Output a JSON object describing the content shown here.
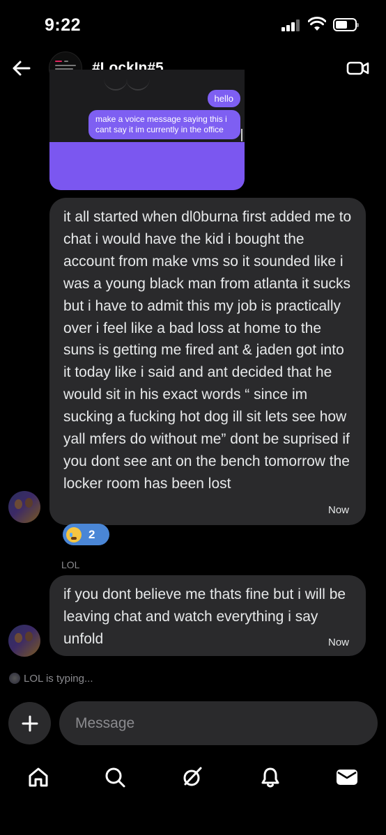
{
  "status_bar": {
    "time": "9:22"
  },
  "header": {
    "title": "#LockIn#5"
  },
  "shared_image": {
    "bubble_hello": "hello",
    "bubble_message": "make a voice message saying this i cant say it im currently in the office"
  },
  "messages": [
    {
      "text": "it all started when dl0burna first added me to chat i would have the kid i bought the account from make vms so it sounded like i was a young black man from atlanta it sucks but i have to admit this my job is practically over i feel like a bad loss at home to the suns is getting me fired ant & jaden got into it today like i said and ant decided that he would sit in his exact words “ since im sucking a fucking hot dog ill sit lets see how yall mfers do without me” dont be suprised if you dont see ant on the bench tomorrow the locker room has been lost",
      "time": "Now",
      "reaction_count": "2"
    },
    {
      "sender": "LOL",
      "text": "if you dont believe me thats fine but i will be leaving chat and watch everything i say unfold",
      "time": "Now"
    }
  ],
  "typing_indicator": "LOL is typing...",
  "composer": {
    "placeholder": "Message"
  },
  "icons": {
    "back": "arrow-left-icon",
    "video": "video-camera-icon",
    "add": "plus-icon",
    "tabs": [
      "home-icon",
      "search-icon",
      "grok-icon",
      "bell-icon",
      "mail-icon"
    ]
  },
  "colors": {
    "background": "#000000",
    "bubble": "#2a2a2c",
    "accent_purple": "#7b57f0",
    "reaction_blue": "#4a86d6",
    "muted_text": "#8b8b8f"
  }
}
